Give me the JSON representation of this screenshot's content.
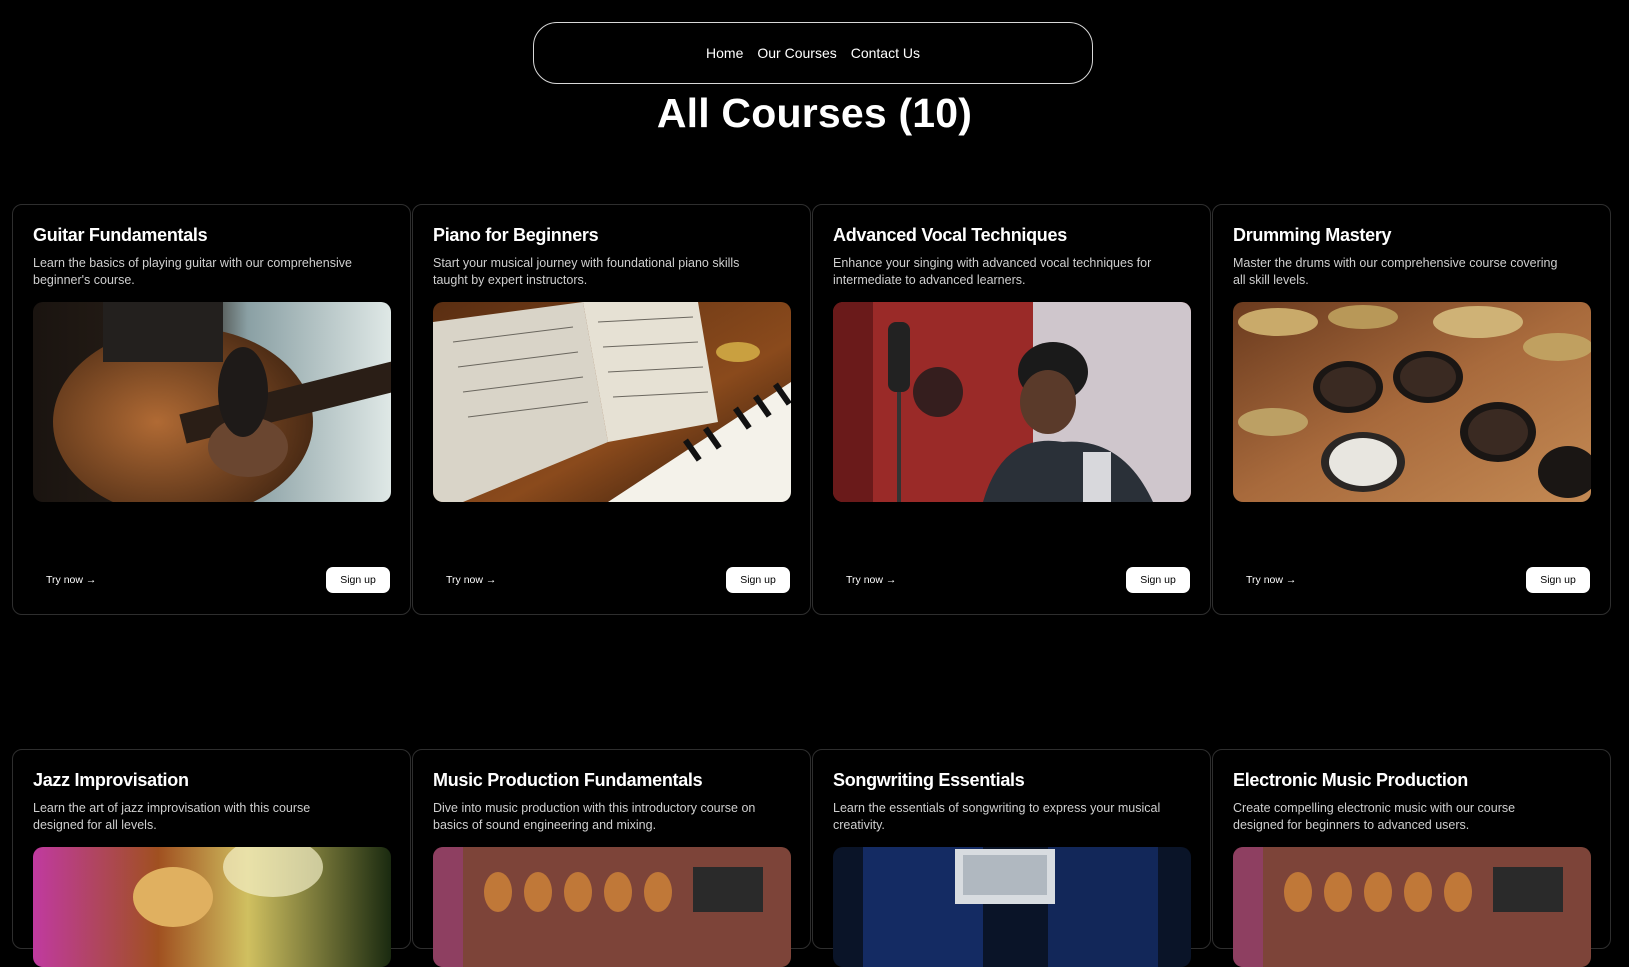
{
  "nav": {
    "home": "Home",
    "courses": "Our Courses",
    "contact": "Contact Us"
  },
  "page_title": "All Courses (10)",
  "cards": [
    {
      "title": "Guitar Fundamentals",
      "description": "Learn the basics of playing guitar with our comprehensive beginner's course.",
      "image_icon": "acoustic-guitar-photo",
      "try_label": "Try now →",
      "signup_label": "Sign up"
    },
    {
      "title": "Piano for Beginners",
      "description": "Start your musical journey with foundational piano skills taught by expert instructors.",
      "image_icon": "piano-sheet-music-photo",
      "try_label": "Try now →",
      "signup_label": "Sign up"
    },
    {
      "title": "Advanced Vocal Techniques",
      "description": "Enhance your singing with advanced vocal techniques for intermediate to advanced learners.",
      "image_icon": "vocalist-microphone-photo",
      "try_label": "Try now →",
      "signup_label": "Sign up"
    },
    {
      "title": "Drumming Mastery",
      "description": "Master the drums with our comprehensive course covering all skill levels.",
      "image_icon": "drum-kit-photo",
      "try_label": "Try now →",
      "signup_label": "Sign up"
    },
    {
      "title": "Jazz Improvisation",
      "description": "Learn the art of jazz improvisation with this course designed for all levels.",
      "image_icon": "saxophone-photo"
    },
    {
      "title": "Music Production Fundamentals",
      "description": "Dive into music production with this introductory course on basics of sound engineering and mixing.",
      "image_icon": "studio-guitars-photo"
    },
    {
      "title": "Songwriting Essentials",
      "description": "Learn the essentials of songwriting to express your musical creativity.",
      "image_icon": "studio-monitor-photo"
    },
    {
      "title": "Electronic Music Production",
      "description": "Create compelling electronic music with our course designed for beginners to advanced users.",
      "image_icon": "studio-guitars-photo"
    }
  ]
}
